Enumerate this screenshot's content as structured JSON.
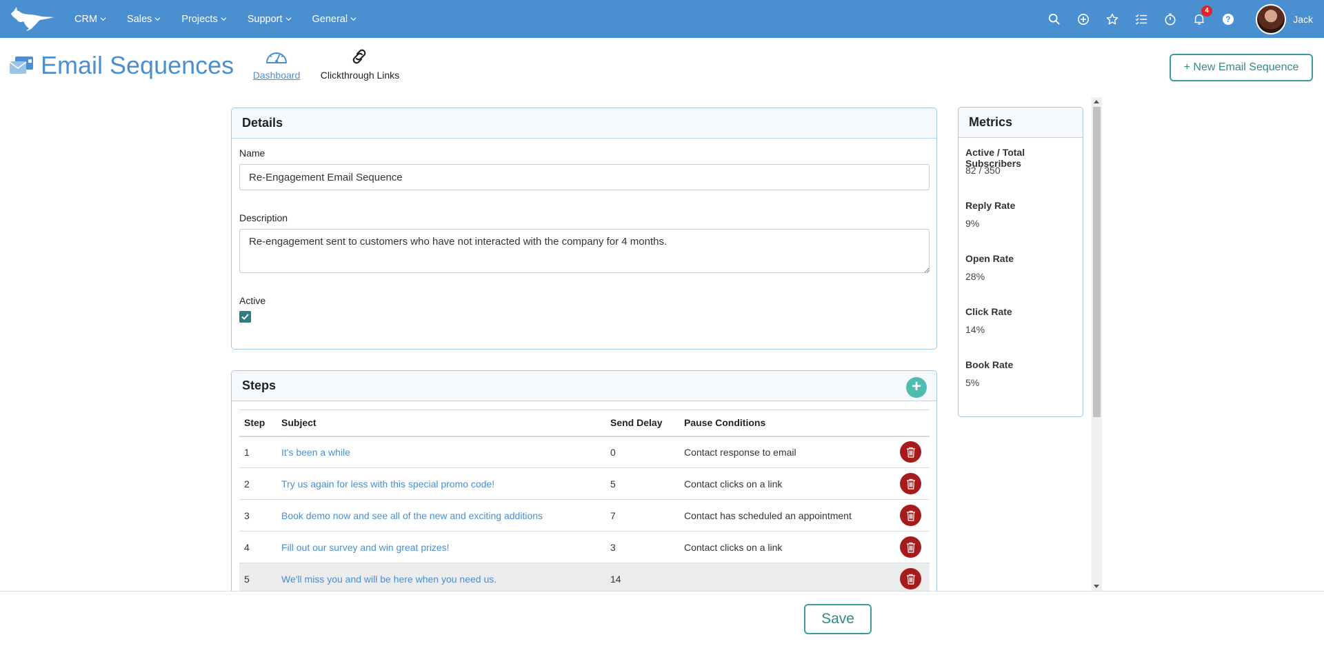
{
  "nav": {
    "logo": "kangaroo-logo",
    "menu": [
      {
        "label": "CRM"
      },
      {
        "label": "Sales"
      },
      {
        "label": "Projects"
      },
      {
        "label": "Support"
      },
      {
        "label": "General"
      }
    ],
    "icons": [
      "search-icon",
      "add-circle-icon",
      "star-icon",
      "tasks-icon",
      "timer-icon",
      "bell-icon",
      "help-icon"
    ],
    "notification_count": "4",
    "user_name": "Jack"
  },
  "header": {
    "title": "Email Sequences",
    "tabs": [
      {
        "label": "Dashboard",
        "icon": "gauge-icon",
        "active": true
      },
      {
        "label": "Clickthrough Links",
        "icon": "link-icon",
        "active": false
      }
    ],
    "new_button_label": "+ New Email Sequence"
  },
  "details": {
    "title": "Details",
    "name_label": "Name",
    "name_value": "Re-Engagement Email Sequence",
    "description_label": "Description",
    "description_value": "Re-engagement sent to customers who have not interacted with the company for 4 months.",
    "active_label": "Active",
    "active": true
  },
  "steps": {
    "title": "Steps",
    "columns": [
      "Step",
      "Subject",
      "Send Delay",
      "Pause Conditions"
    ],
    "rows": [
      {
        "step": "1",
        "subject": "It's been a while",
        "delay": "0",
        "pause": "Contact response to email"
      },
      {
        "step": "2",
        "subject": "Try us again for less with this special promo code!",
        "delay": "5",
        "pause": "Contact clicks on a link"
      },
      {
        "step": "3",
        "subject": "Book demo now and see all of the new and exciting additions",
        "delay": "7",
        "pause": "Contact has scheduled an appointment"
      },
      {
        "step": "4",
        "subject": "Fill out our survey and win great prizes!",
        "delay": "3",
        "pause": "Contact clicks on a link"
      },
      {
        "step": "5",
        "subject": "We'll miss you and will be here when you need us.",
        "delay": "14",
        "pause": ""
      }
    ]
  },
  "metrics": {
    "title": "Metrics",
    "items": [
      {
        "label": "Active / Total Subscribers",
        "value": "82 / 350"
      },
      {
        "label": "Reply Rate",
        "value": "9%"
      },
      {
        "label": "Open Rate",
        "value": "28%"
      },
      {
        "label": "Click Rate",
        "value": "14%"
      },
      {
        "label": "Book Rate",
        "value": "5%"
      }
    ]
  },
  "footer": {
    "save_label": "Save"
  },
  "colors": {
    "nav_bg": "#4a8fcf",
    "accent_teal": "#3a9e9a",
    "link_blue": "#4a8fcf",
    "delete_red": "#a61c1c"
  }
}
